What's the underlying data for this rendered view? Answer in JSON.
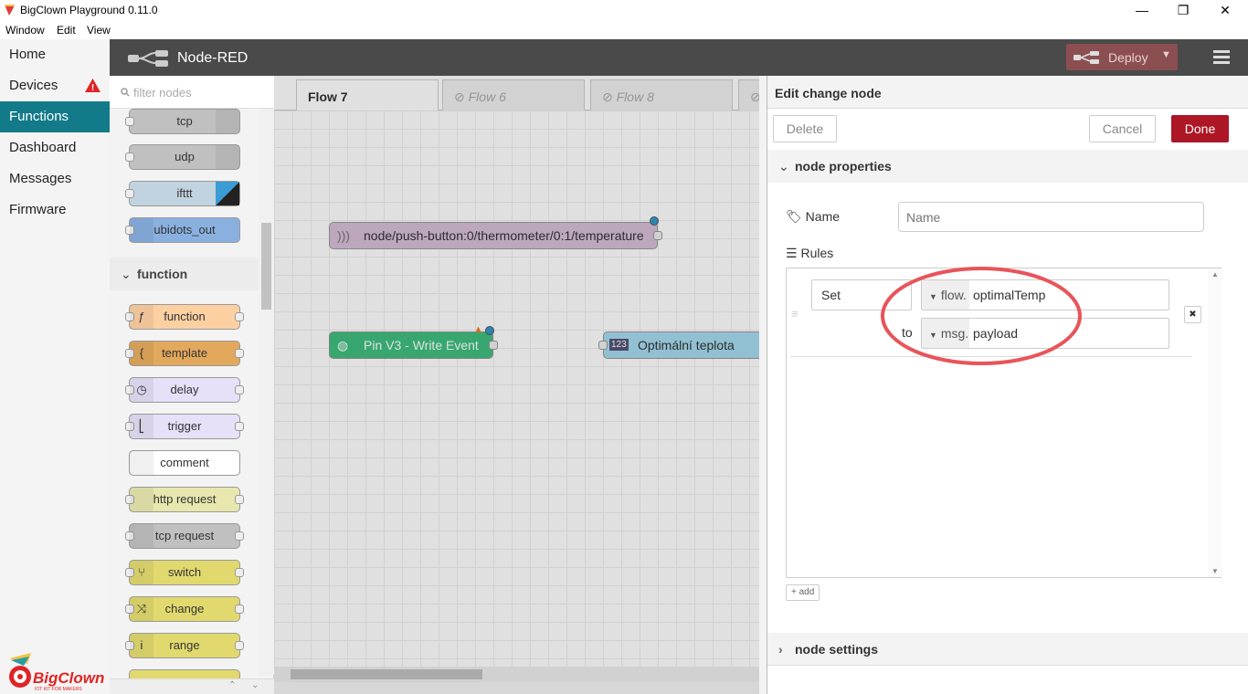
{
  "window": {
    "title": "BigClown Playground 0.11.0",
    "menu": [
      "Window",
      "Edit",
      "View"
    ],
    "minimize": "—",
    "maximize": "❐",
    "close": "✕"
  },
  "app_nav": {
    "items": [
      {
        "label": "Home"
      },
      {
        "label": "Devices",
        "alert": "!"
      },
      {
        "label": "Functions"
      },
      {
        "label": "Dashboard"
      },
      {
        "label": "Messages"
      },
      {
        "label": "Firmware"
      }
    ],
    "active": "Functions",
    "logo_text": "BigClown",
    "logo_tagline": "IOT KIT FOR MAKERS"
  },
  "header": {
    "brand": "Node-RED",
    "deploy_label": "Deploy",
    "deploy_color": "#8c4f51"
  },
  "palette": {
    "filter_placeholder": "filter nodes",
    "nodes_top": [
      "tcp",
      "udp",
      "ifttt",
      "ubidots_out"
    ],
    "category": "function",
    "nodes_function": [
      "function",
      "template",
      "delay",
      "trigger",
      "comment",
      "http request",
      "tcp request",
      "switch",
      "change",
      "range"
    ]
  },
  "workspace": {
    "tabs": [
      {
        "label": "Flow 7",
        "active": true
      },
      {
        "label": "Flow 6",
        "disabled": true
      },
      {
        "label": "Flow 8",
        "disabled": true
      }
    ],
    "nodes": [
      {
        "label": "node/push-button:0/thermometer/0:1/temperature"
      },
      {
        "label": "Pin V3 - Write Event"
      },
      {
        "label": "Optimální teplota",
        "badge": "123"
      }
    ]
  },
  "editor": {
    "title": "Edit change node",
    "delete_label": "Delete",
    "cancel_label": "Cancel",
    "done_label": "Done",
    "props_section": "node properties",
    "name_label": "Name",
    "name_placeholder": "Name",
    "rules_label": "Rules",
    "rule": {
      "action": "Set",
      "target_type": "flow.",
      "target_value": "optimalTemp",
      "to_label": "to",
      "source_type": "msg.",
      "source_value": "payload"
    },
    "add_label": "add",
    "settings_section": "node settings",
    "highlight_color": "#e8545a"
  }
}
